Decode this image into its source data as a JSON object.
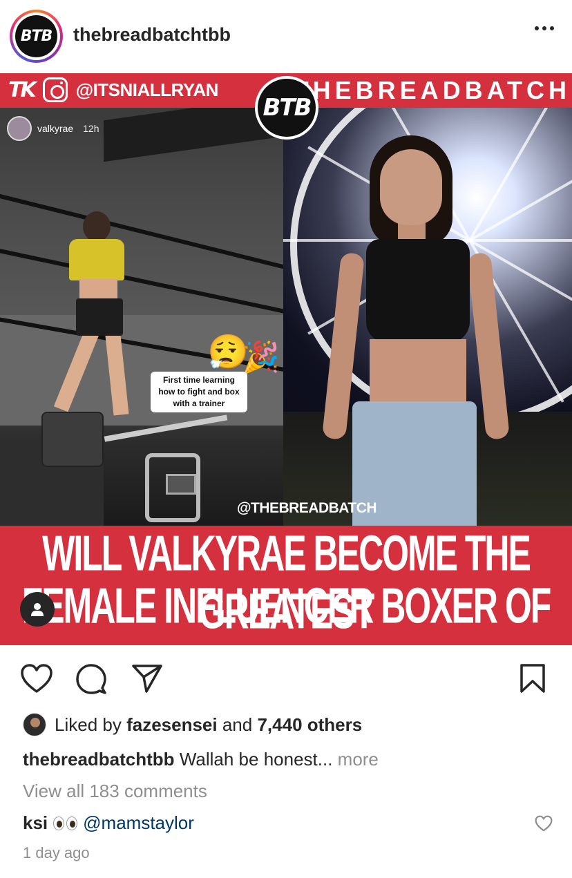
{
  "header": {
    "username": "thebreadbatchtbb",
    "avatar_logo": "BTB"
  },
  "post_image": {
    "banner": {
      "brand_left": "TK",
      "instagram_handle": "@ITSNIALLRYAN",
      "brand_right": "THEBREADBATCH",
      "center_logo": "BTB"
    },
    "story": {
      "username": "valkyrae",
      "time": "12h",
      "caption_line1": "First time learning",
      "caption_line2": "how to fight and box",
      "caption_line3": "with a trainer",
      "emoji_1": "😮‍💨",
      "emoji_2": "🎉"
    },
    "watermark": "@THEBREADBATCH",
    "headline_line1": "WILL VALKYRAE BECOME THE GREATEST",
    "headline_line2": "FEMALE INFLUENCER BOXER OF ALL TIME?"
  },
  "actions": {
    "like_icon": "heart-icon",
    "comment_icon": "comment-icon",
    "share_icon": "paper-plane-icon",
    "save_icon": "bookmark-icon"
  },
  "likes": {
    "prefix": "Liked by",
    "user": "fazesensei",
    "and": "and",
    "others": "7,440 others"
  },
  "caption": {
    "username": "thebreadbatchtbb",
    "text": "Wallah be honest...",
    "more": "more"
  },
  "comments": {
    "view_all": "View all 183 comments",
    "first": {
      "username": "ksi",
      "emoji": "👀",
      "mention": "@mamstaylor"
    }
  },
  "timestamp": "1 day ago",
  "colors": {
    "accent_red": "#d4303e",
    "text": "#262626",
    "muted": "#8e8e8e",
    "mention": "#00376b"
  }
}
